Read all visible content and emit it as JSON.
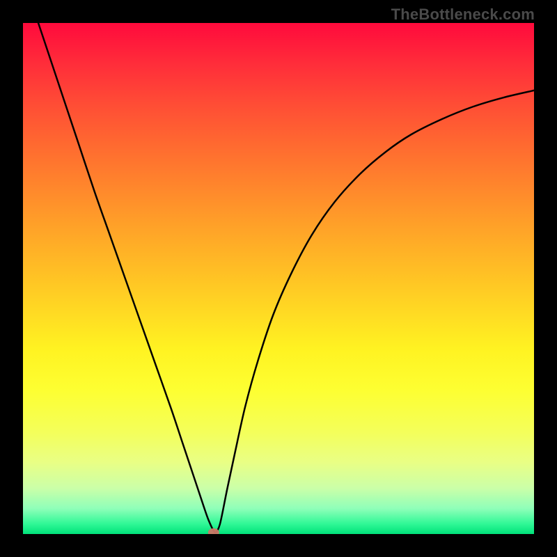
{
  "watermark": "TheBottleneck.com",
  "colors": {
    "curve": "#000000",
    "marker": "#cc7766",
    "frame": "#000000"
  },
  "chart_data": {
    "type": "line",
    "title": "",
    "xlabel": "",
    "ylabel": "",
    "xlim": [
      0,
      100
    ],
    "ylim": [
      0,
      100
    ],
    "series": [
      {
        "name": "bottleneck-curve",
        "x": [
          3,
          5,
          8,
          11,
          14,
          17,
          20,
          23,
          26,
          29,
          31,
          33,
          34.5,
          35.5,
          36.2,
          36.8,
          37.2,
          37.6,
          38,
          38.5,
          39,
          40,
          41.5,
          43.5,
          46,
          49,
          52.5,
          56.5,
          61,
          66,
          71,
          76,
          82,
          88,
          94,
          100
        ],
        "y": [
          100,
          94,
          85,
          76,
          67,
          58.5,
          50,
          41.5,
          33,
          24.5,
          18.5,
          12.5,
          8,
          5,
          3,
          1.6,
          0.8,
          0.3,
          0.6,
          1.8,
          4,
          9,
          16,
          25,
          34,
          43,
          51,
          58.5,
          65,
          70.5,
          74.8,
          78.2,
          81.2,
          83.6,
          85.4,
          86.8
        ]
      }
    ],
    "marker": {
      "x": 37.3,
      "y": 0.3
    },
    "grid": false,
    "legend": false
  }
}
